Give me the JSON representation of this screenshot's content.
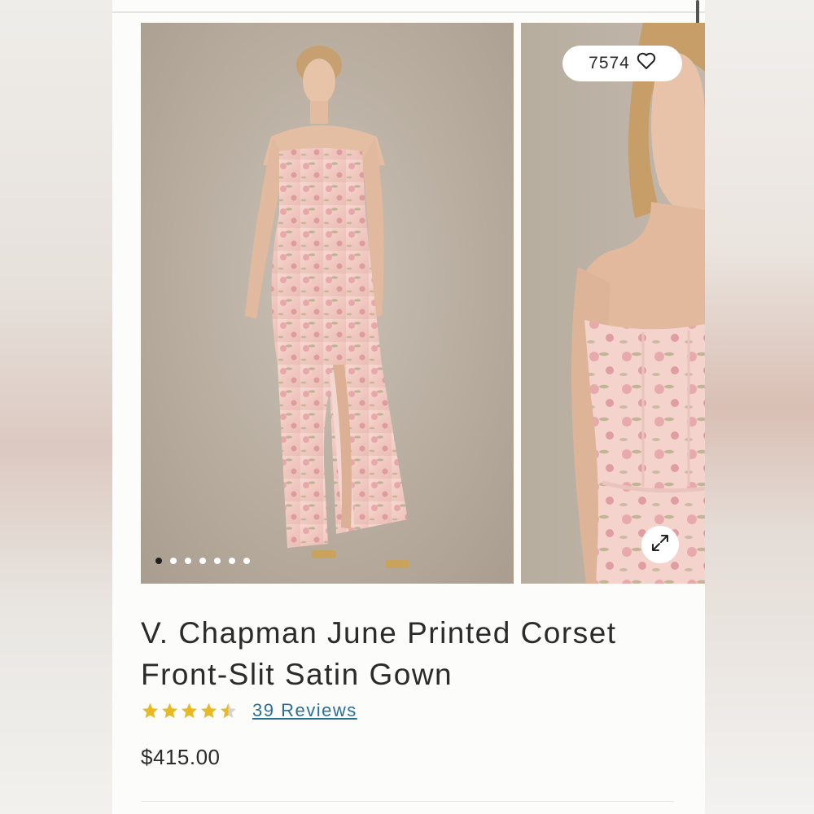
{
  "favorites": {
    "count": "7574",
    "icon": "heart-icon"
  },
  "gallery": {
    "image_count": 7,
    "active_index": 0,
    "expand_icon": "expand-arrows-icon"
  },
  "product": {
    "title_line1": "V. Chapman June Printed Corset",
    "title_line2": "Front-Slit Satin Gown",
    "rating_stars": 4.5,
    "reviews_label": "39 Reviews",
    "price": "$415.00"
  },
  "colors": {
    "star": "#e8b923",
    "link": "#2a6f97",
    "text": "#2b2b2b",
    "dress": "#f2cfc8"
  }
}
